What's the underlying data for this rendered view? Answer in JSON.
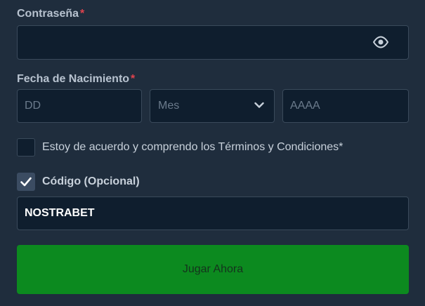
{
  "password": {
    "label": "Contraseña",
    "required_mark": "*",
    "value": "",
    "toggle_icon": "eye-icon"
  },
  "birthdate": {
    "label": "Fecha de Nacimiento",
    "required_mark": "*",
    "day_placeholder": "DD",
    "month_selected": "Mes",
    "year_placeholder": "AAAA"
  },
  "terms": {
    "checked": false,
    "label": "Estoy de acuerdo y comprendo los Términos y Condiciones*"
  },
  "promo": {
    "checked": true,
    "label": "Código (Opcional)",
    "value": "NOSTRABET"
  },
  "submit": {
    "label": "Jugar Ahora"
  },
  "colors": {
    "background": "#1f2d3d",
    "field_background": "#0f1e2e",
    "field_border": "#3a4a5b",
    "required": "#e0424d",
    "submit_background": "#0c8a1f"
  }
}
